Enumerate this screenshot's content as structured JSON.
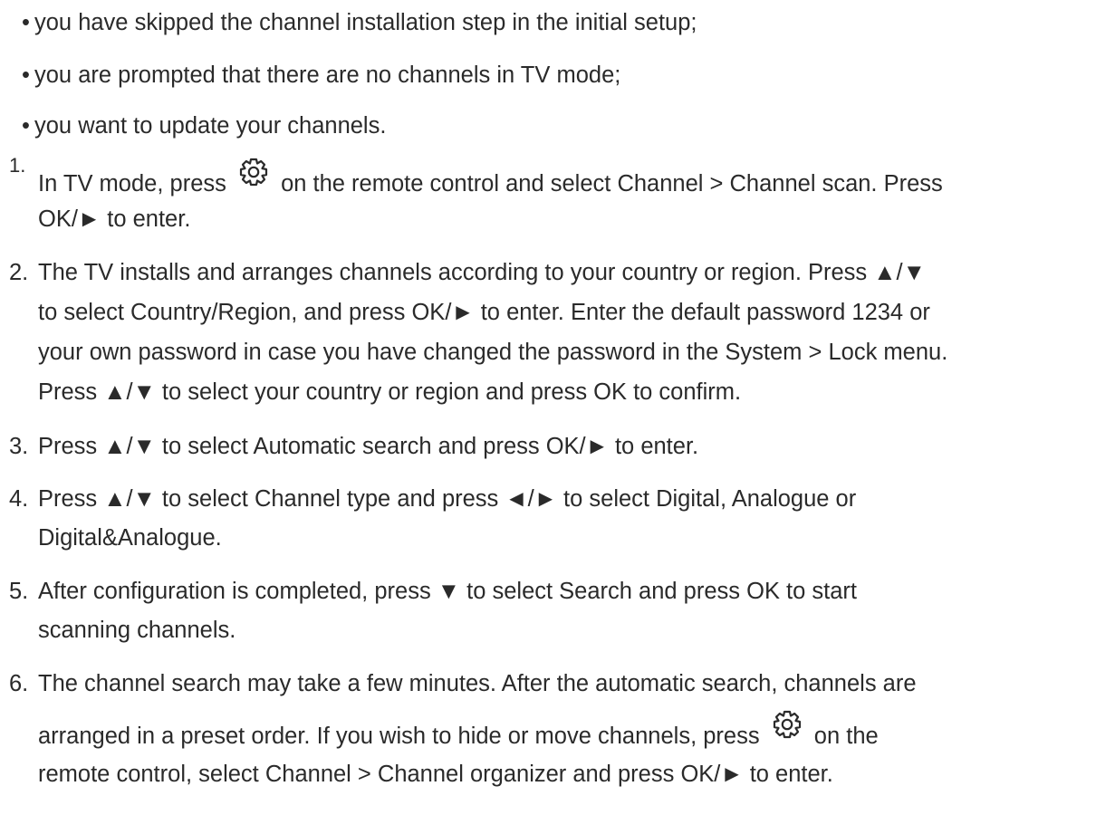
{
  "bullets": [
    "you have skipped the channel installation step in the initial setup;",
    "you are prompted that there are no channels in TV mode;",
    "you want to update your channels."
  ],
  "bullet_symbol": "•",
  "steps": {
    "s1": {
      "num": "1.",
      "a": "In TV mode, press",
      "b": "on the remote control and select Channel > Channel scan. Press",
      "c": "OK/► to enter."
    },
    "s2": {
      "num": "2.",
      "l1": "The TV installs and arranges channels according to your country or region. Press ▲/▼",
      "l2": "to select Country/Region, and press OK/► to enter. Enter the default password 1234 or",
      "l3": "your own password in case you have changed the password in the System > Lock menu.",
      "l4": "Press ▲/▼ to select your country or region and press OK to confirm."
    },
    "s3": {
      "num": "3.",
      "l1": "Press ▲/▼ to select Automatic search and press OK/► to enter."
    },
    "s4": {
      "num": "4.",
      "l1": "Press ▲/▼ to select Channel type and press ◄/► to select Digital, Analogue or",
      "l2": "Digital&Analogue."
    },
    "s5": {
      "num": "5.",
      "l1": "After configuration is completed, press ▼ to select Search and press OK to start",
      "l2": "scanning channels."
    },
    "s6": {
      "num": "6.",
      "l1": "The channel search may take a few minutes. After the automatic search, channels are",
      "l2a": "arranged in a preset order. If you wish to hide or move channels, press",
      "l2b": "on the",
      "l3": "remote control, select Channel > Channel organizer and press OK/► to enter."
    }
  },
  "icons": {
    "settings": "gear-icon"
  }
}
